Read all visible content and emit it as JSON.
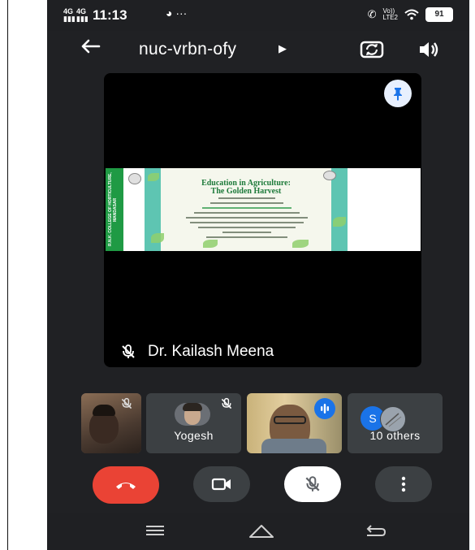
{
  "status_bar": {
    "time": "11:13",
    "net1": "4G",
    "net2": "4G",
    "more": "···",
    "volte": "Vo))\nLTE2",
    "battery": "91"
  },
  "top_bar": {
    "meeting_code": "nuc-vrbn-ofy"
  },
  "main_tile": {
    "participant_name": "Dr. Kailash Meena",
    "slide": {
      "title_line1": "Education in Agriculture:",
      "title_line2": "The Golden Harvest",
      "side_text": "R.N.K. COLLEGE OF HORTICULTURE, MANDASAR"
    }
  },
  "thumbnails": [
    {
      "label": ""
    },
    {
      "label": "Yogesh"
    },
    {
      "label": ""
    },
    {
      "label": "10 others",
      "avatar_letter": "S"
    }
  ],
  "icons": [
    "back-arrow-icon",
    "dropdown-arrow-icon",
    "switch-camera-icon",
    "speaker-icon",
    "pin-icon",
    "mic-off-icon",
    "end-call-icon",
    "camera-icon",
    "more-vert-icon",
    "audio-level-icon",
    "nav-recents-icon",
    "nav-home-icon",
    "nav-back-icon"
  ],
  "colors": {
    "background": "#202124",
    "end_call": "#ea4335",
    "pin_bg": "#e8f0fe",
    "avatar_s": "#1a73e8"
  }
}
